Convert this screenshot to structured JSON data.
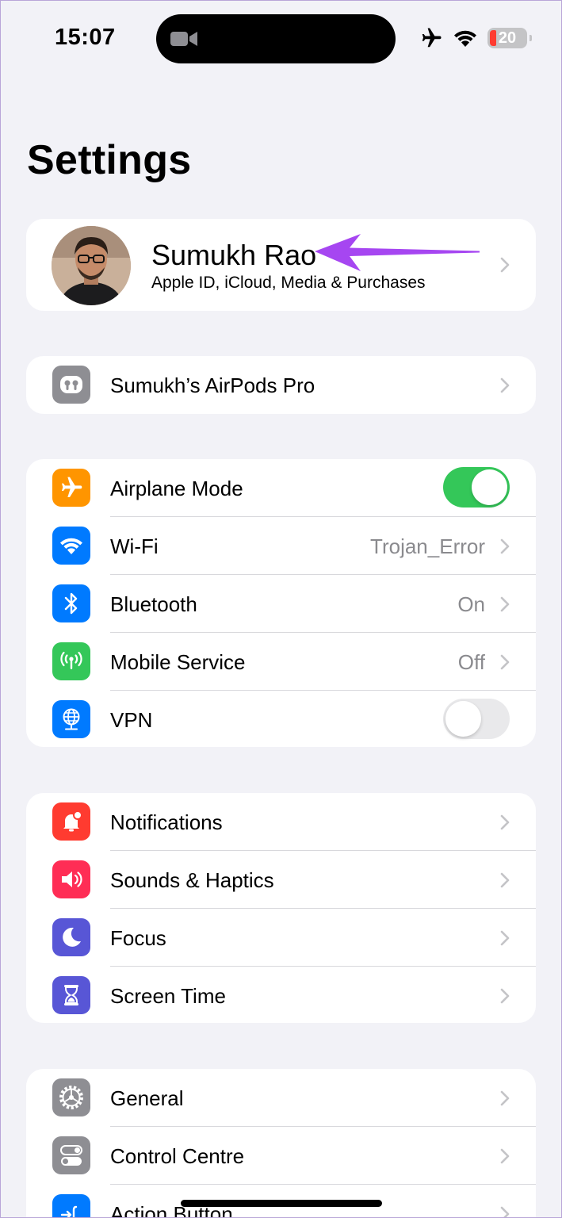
{
  "status_bar": {
    "time": "15:07",
    "battery_level": "20",
    "battery_color": "#ff3b30",
    "icons": [
      "video-camera-icon",
      "airplane-icon",
      "wifi-icon",
      "battery-icon"
    ]
  },
  "title": "Settings",
  "profile": {
    "name": "Sumukh Rao",
    "subtitle": "Apple ID, iCloud, Media & Purchases"
  },
  "airpods": {
    "label": "Sumukh’s AirPods Pro",
    "icon": "airpods-icon",
    "color": "#8e8e93"
  },
  "connectivity": [
    {
      "label": "Airplane Mode",
      "icon": "airplane-icon",
      "color": "#ff9500",
      "toggle": "on"
    },
    {
      "label": "Wi-Fi",
      "icon": "wifi-icon",
      "color": "#007aff",
      "value": "Trojan_Error"
    },
    {
      "label": "Bluetooth",
      "icon": "bluetooth-icon",
      "color": "#007aff",
      "value": "On"
    },
    {
      "label": "Mobile Service",
      "icon": "antenna-icon",
      "color": "#34c759",
      "value": "Off"
    },
    {
      "label": "VPN",
      "icon": "globe-icon",
      "color": "#007aff",
      "toggle": "off"
    }
  ],
  "notifications_group": [
    {
      "label": "Notifications",
      "icon": "bell-icon",
      "color": "#ff3b30"
    },
    {
      "label": "Sounds & Haptics",
      "icon": "speaker-icon",
      "color": "#ff2d55"
    },
    {
      "label": "Focus",
      "icon": "moon-icon",
      "color": "#5856d6"
    },
    {
      "label": "Screen Time",
      "icon": "hourglass-icon",
      "color": "#5856d6"
    }
  ],
  "general_group": [
    {
      "label": "General",
      "icon": "gear-icon",
      "color": "#8e8e93"
    },
    {
      "label": "Control Centre",
      "icon": "switches-icon",
      "color": "#8e8e93"
    },
    {
      "label": "Action Button",
      "icon": "action-button-icon",
      "color": "#007aff"
    }
  ]
}
